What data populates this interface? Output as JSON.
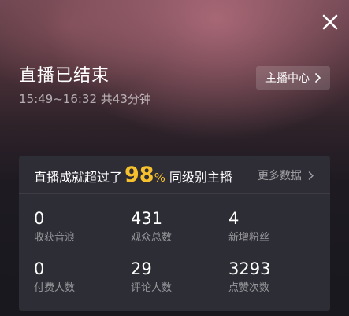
{
  "header": {
    "title": "直播已结束",
    "time_range": "15:49~16:32 共43分钟",
    "anchor_center_label": "主播中心"
  },
  "achievement": {
    "prefix": "直播成就超过了",
    "percent": "98",
    "percent_sign": "%",
    "suffix": "同级别主播",
    "more_label": "更多数据"
  },
  "stats": [
    {
      "value": "0",
      "label": "收获音浪"
    },
    {
      "value": "431",
      "label": "观众总数"
    },
    {
      "value": "4",
      "label": "新增粉丝"
    },
    {
      "value": "0",
      "label": "付费人数"
    },
    {
      "value": "29",
      "label": "评论人数"
    },
    {
      "value": "3293",
      "label": "点赞次数"
    }
  ],
  "colors": {
    "highlight": "#f7c12e",
    "card_bg": "#303038"
  },
  "icons": {
    "close": "close-icon",
    "chevron": "chevron-right-icon"
  }
}
